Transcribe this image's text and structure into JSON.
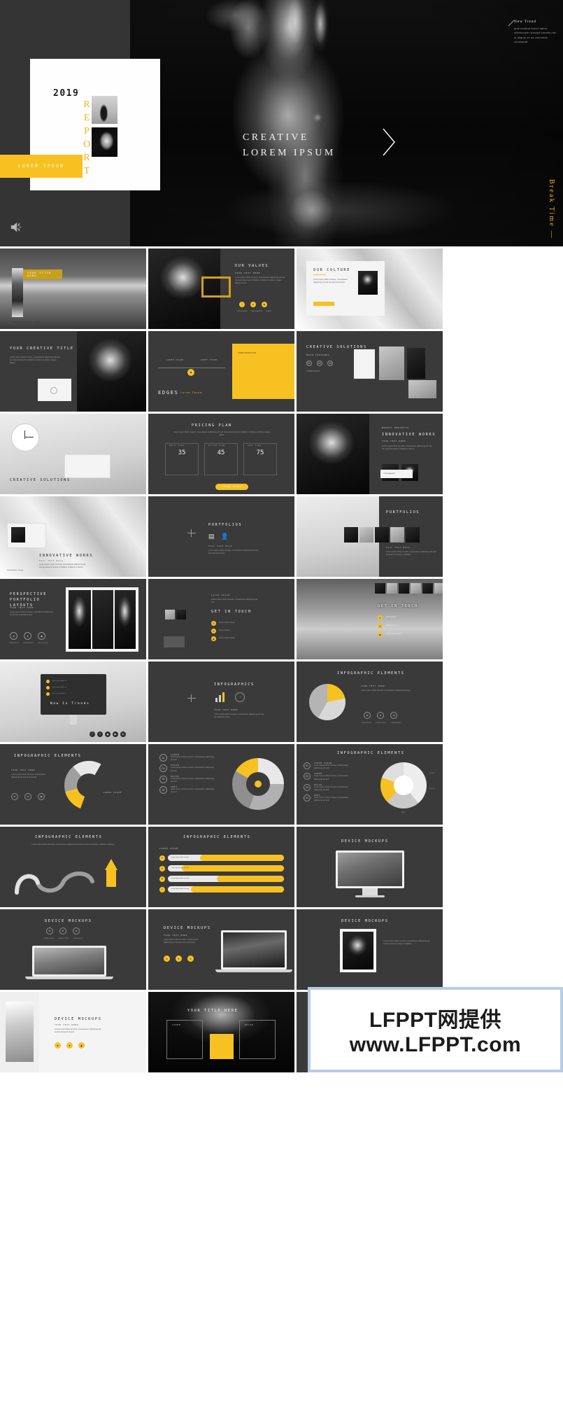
{
  "hero": {
    "year": "2019",
    "report_letters": [
      "R",
      "E",
      "P",
      "O",
      "R",
      "T"
    ],
    "button_label": "LOREM IPSUM",
    "headline_line1": "CREATIVE",
    "headline_line2": "LOREM IPSUM",
    "note_title": "New Trend",
    "note_body": "quis nostrud exerci tation ullamcorper suscipit lobortis nisl ut aliquip ex ea commodo consequat.",
    "vertical_text": "Break Time —",
    "next_icon": "chevron-right-icon",
    "speaker_icon": "speaker-icon",
    "accent_color": "#f7c122",
    "background_color": "#343434"
  },
  "watermark": {
    "line1": "LFPPT网提供",
    "line2": "www.LFPPT.com",
    "border_color": "#b8cce4"
  },
  "slides": [
    {
      "id": "s01",
      "name": "your-title-here",
      "title": "YOUR TITLE HERE",
      "caption": "PHOTO COMPANY LOGO",
      "style": "beach-hero"
    },
    {
      "id": "s02",
      "name": "our-values",
      "title": "OUR VALUES",
      "sub": "YOUR TEXT HERE",
      "body": "Lorem ipsum dolor sit amet, consectetuer adipiscing elit sed do eiusmod tempor incididunt ut labore et dolore magna aliqua ut enim.",
      "buttons": [
        "LOREM IPSUM",
        "MAIN FEATURE",
        "LOREM"
      ],
      "style": "values"
    },
    {
      "id": "s03",
      "name": "our-culture",
      "title": "OUR CULTURE",
      "body": "Lorem ipsum dolor sit amet, consectetuer adipiscing elit sed do eiusmod tempor.",
      "style": "culture"
    },
    {
      "id": "s04",
      "name": "your-creative-title",
      "title": "YOUR CREATIVE TITLE",
      "body": "Lorem ipsum dolor sit amet, consectetuer adipiscing elit sed do eiusmod tempor incididunt ut labore et dolore magna aliqua.",
      "style": "creative-title"
    },
    {
      "id": "s05",
      "name": "edges-diagram",
      "title": "EDGES",
      "sub": "Lorem Ipsum",
      "labels": [
        "LOREM IPSUM",
        "LOREM IPSUM"
      ],
      "panel_text": "LOREM IPSUM DOLOR",
      "style": "edges"
    },
    {
      "id": "s06",
      "name": "creative-solutions-a",
      "title": "CREATIVE SOLUTIONS",
      "sub": "MAIN FEATURES",
      "steps": [
        "01",
        "02",
        "03"
      ],
      "buttons": [
        "LOREM IPSUM",
        "LOREM IPSUM"
      ],
      "style": "solutions-a"
    },
    {
      "id": "s07",
      "name": "creative-solutions-b",
      "title": "CREATIVE SOLUTIONS",
      "style": "clock"
    },
    {
      "id": "s08",
      "name": "pricing-plan",
      "title": "PRICING PLAN",
      "body": "Lorem ipsum dolor sit amet, consectetuer adipiscing elit sed do eiusmod tempor incididunt ut labore et dolore magna aliqua.",
      "plans": [
        {
          "label": "BASIC PLAN",
          "price": "35"
        },
        {
          "label": "SILVER PLAN",
          "price": "45"
        },
        {
          "label": "GOLD PLAN",
          "price": "75"
        }
      ],
      "cta": "LOREM IPSUM",
      "style": "pricing"
    },
    {
      "id": "s09",
      "name": "innovative-works-a",
      "title": "INNOVATIVE WORKS",
      "sub": "NEWEST PROJECTS",
      "kicker": "YOUR TEXT HERE",
      "body": "Lorem ipsum dolor sit amet, consectetuer adipiscing elit sed do eiusmod tempor incididunt ut labore.",
      "caption": "YOUR GALLERY",
      "style": "works-a"
    },
    {
      "id": "s10",
      "name": "innovative-works-b",
      "title": "INNOVATIVE WORKS",
      "sub": "Your Text Here",
      "body": "Lorem ipsum dolor sit amet, consectetuer adipiscing elit sed do eiusmod tempor incididunt ut labore et dolore.",
      "caption": "Perfectly Neat + Design",
      "style": "works-b"
    },
    {
      "id": "s11",
      "name": "portfolios-icons",
      "title": "PORTFOLIOS",
      "sub": "Your Text Here",
      "body": "Lorem ipsum dolor sit amet, consectetuer adipiscing elit sed do eiusmod tempor.",
      "style": "portfolio-icons"
    },
    {
      "id": "s12",
      "name": "portfolios-gallery",
      "title": "PORTFOLIOS",
      "sub": "Your Text Here",
      "body": "Lorem ipsum dolor sit amet, consectetuer adipiscing elit sed do eiusmod tempor incididunt.",
      "style": "portfolio-gallery"
    },
    {
      "id": "s13",
      "name": "perspective-portfolio-layouts",
      "title": "PERSPECTIVE PORTFOLIO LAYOUTS",
      "sub": "YOUR TEXT HERE",
      "body": "Lorem ipsum dolor sit amet, consectetuer adipiscing elit sed do eiusmod tempor.",
      "buttons": [
        "LOREM IPSUM",
        "LOREM IPSUM",
        "GET IN TOUCH"
      ],
      "style": "perspective"
    },
    {
      "id": "s14",
      "name": "get-in-touch-a",
      "title": "GET IN TOUCH",
      "sub": "Lorem Ipsum",
      "body": "Lorem ipsum dolor sit amet, consectetuer adipiscing elit sed.",
      "contacts": [
        "Lorem Ipsum Dolor",
        "Lorem Ipsum",
        "Lorem Ipsum Dolor"
      ],
      "style": "touch-a"
    },
    {
      "id": "s15",
      "name": "get-in-touch-b",
      "title": "GET IN TOUCH",
      "contacts": [
        "Lorem Ipsum",
        "Lorem Ipsum",
        "Lorem Ipsum Dolor"
      ],
      "style": "touch-b"
    },
    {
      "id": "s16",
      "name": "desktop-mockup",
      "title": "Now In Trends",
      "body": "Lorem ipsum dolor sit amet, consectetuer adipiscing elit.",
      "style": "desktop"
    },
    {
      "id": "s17",
      "name": "infographics",
      "title": "INFOGRAPHICS",
      "sub": "YOUR TEXT HERE",
      "body": "Lorem ipsum dolor sit amet, consectetuer adipiscing elit sed do eiusmod tempor.",
      "style": "infographics"
    },
    {
      "id": "s18",
      "name": "infographic-elements-pie",
      "title": "INFOGRAPHIC ELEMENTS",
      "sub": "YOUR TEXT HERE",
      "body": "Lorem ipsum dolor sit amet consectetuer adipiscing elit sed.",
      "buttons": [
        "LOREM IPSUM",
        "LOREM IPSUM",
        "LOREM IPSUM"
      ],
      "style": "pie"
    },
    {
      "id": "s19",
      "name": "infographic-elements-gauge",
      "title": "INFOGRAPHIC ELEMENTS",
      "sub": "YOUR TEXT HERE",
      "body": "Lorem ipsum dolor sit amet, consectetuer adipiscing elit sed do eiusmod.",
      "label": "LOREM IPSUM",
      "style": "gauge"
    },
    {
      "id": "s20",
      "name": "infographic-elements-rings",
      "title": "INFOGRAPHIC ELEMENTS",
      "rows": [
        {
          "n": "01",
          "t": "LOREM",
          "d": "Lorem ipsum dolor sit amet, consectetuer adipiscing elit sed"
        },
        {
          "n": "02",
          "t": "IPSUM",
          "d": "Lorem ipsum dolor sit amet, consectetuer adipiscing elit sed"
        },
        {
          "n": "03",
          "t": "DOLOR",
          "d": "Lorem ipsum dolor sit amet, consectetuer adipiscing elit sed"
        },
        {
          "n": "04",
          "t": "AMET",
          "d": "Lorem ipsum dolor sit amet, consectetuer adipiscing elit sed"
        }
      ],
      "style": "rings"
    },
    {
      "id": "s21",
      "name": "infographic-elements-donut",
      "title": "INFOGRAPHIC ELEMENTS",
      "rows": [
        {
          "n": "01",
          "t": "LOREM IPSUM",
          "d": "Lorem ipsum dolor sit amet, consectetuer adipiscing elit sed"
        },
        {
          "n": "02",
          "t": "LOREM",
          "d": "Lorem ipsum dolor sit amet, consectetuer adipiscing elit sed"
        },
        {
          "n": "03",
          "t": "DOLOR",
          "d": "Lorem ipsum dolor sit amet, consectetuer adipiscing elit sed"
        },
        {
          "n": "04",
          "t": "AMET",
          "d": "Lorem ipsum dolor sit amet, consectetuer adipiscing elit sed"
        }
      ],
      "legend": [
        "IPSUM",
        "DOLOR",
        "AMET"
      ],
      "style": "donut"
    },
    {
      "id": "s22",
      "name": "infographic-elements-roadmap",
      "title": "INFOGRAPHIC ELEMENTS",
      "body": "Lorem ipsum dolor sit amet, consectetuer adipiscing elit sed do eiusmod tempor incididunt ut labore.",
      "style": "roadmap"
    },
    {
      "id": "s23",
      "name": "infographic-elements-bars",
      "title": "INFOGRAPHIC ELEMENTS",
      "sub": "LOREM IPSUM",
      "bars": [
        {
          "label": "Lorem ipsum dolor sit amet",
          "pct": 72
        },
        {
          "label": "Lorem ipsum dolor sit amet",
          "pct": 88
        },
        {
          "label": "Lorem ipsum dolor sit amet",
          "pct": 58
        },
        {
          "label": "Lorem ipsum dolor sit amet",
          "pct": 80
        }
      ],
      "style": "bars"
    },
    {
      "id": "s24",
      "name": "device-mockups-imac",
      "title": "DEVICE MOCKUPS",
      "style": "imac"
    },
    {
      "id": "s25",
      "name": "device-mockups-macbook-a",
      "title": "DEVICE MOCKUPS",
      "buttons": [
        "LOREM IPSUM",
        "LOREM IPSUM",
        "LOREM IPSUM"
      ],
      "style": "macbook-a"
    },
    {
      "id": "s26",
      "name": "device-mockups-macbook-b",
      "title": "DEVICE MOCKUPS",
      "sub": "YOUR TEXT HERE",
      "body": "Lorem ipsum dolor sit amet, consectetuer adipiscing elit sed do eiusmod tempor.",
      "style": "macbook-b"
    },
    {
      "id": "s27",
      "name": "device-mockups-frame",
      "title": "DEVICE MOCKUPS",
      "body": "Lorem ipsum dolor sit amet, consectetuer adipiscing elit sed do eiusmod tempor incididunt.",
      "style": "frame"
    },
    {
      "id": "s28",
      "name": "device-mockups-poster",
      "title": "DEVICE MOCKUPS",
      "sub": "YOUR TEXT HERE",
      "body": "Lorem ipsum dolor sit amet, consectetuer adipiscing elit sed do eiusmod tempor.",
      "style": "poster"
    },
    {
      "id": "s29",
      "name": "your-title-here-closing",
      "title": "YOUR TITLE HERE",
      "cards": [
        "LOREM",
        "DOLOR"
      ],
      "style": "closing"
    },
    {
      "id": "s30",
      "name": "thank-you",
      "title": "",
      "style": "blank"
    }
  ]
}
